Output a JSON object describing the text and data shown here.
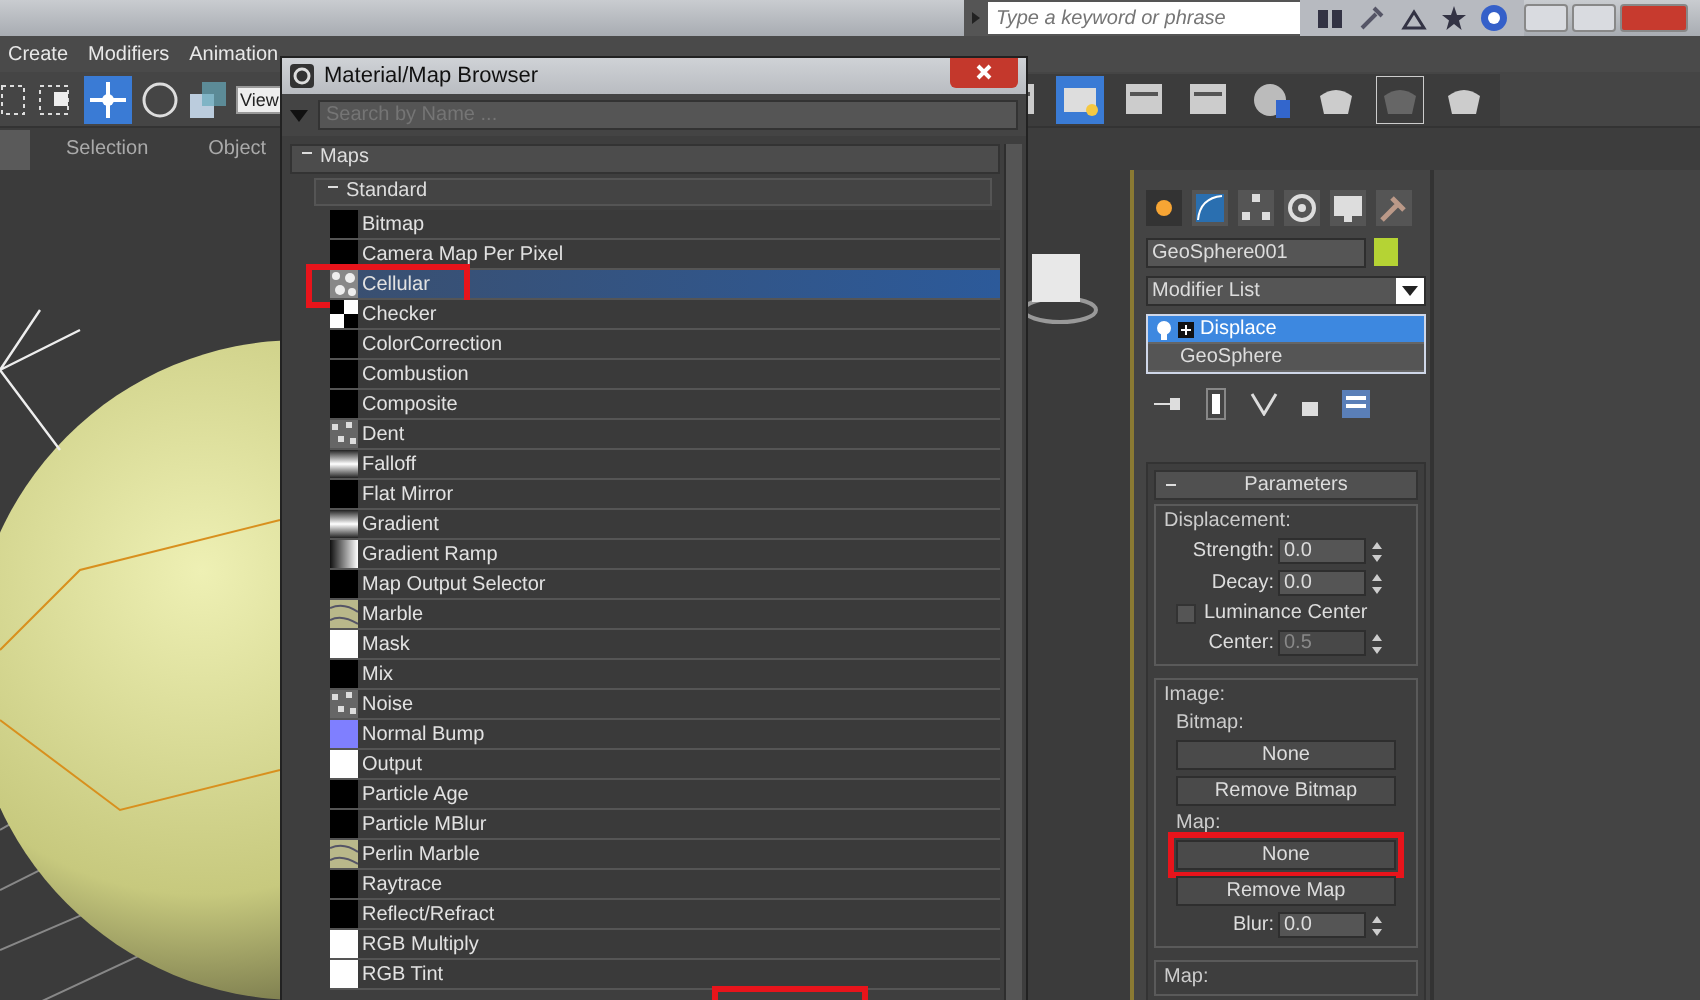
{
  "menu_bar": {
    "items": [
      "Create",
      "Modifiers",
      "Animation"
    ]
  },
  "search_bar": {
    "placeholder": "Type a keyword or phrase"
  },
  "toolbar": {
    "view_dropdown": "View"
  },
  "ribbon_tabs": [
    {
      "label": "Selection",
      "selected": false
    },
    {
      "label": "Object",
      "selected": false
    }
  ],
  "browser": {
    "title": "Material/Map Browser",
    "search": {
      "placeholder": "Search by Name ..."
    },
    "group": {
      "label": "Maps",
      "expanded": true
    },
    "subgroup": {
      "label": "Standard",
      "expanded": true
    },
    "maps": [
      {
        "name": "Bitmap",
        "kind": "solid",
        "color": "#000000",
        "selected": false,
        "highlighted": false
      },
      {
        "name": "Camera Map Per Pixel",
        "kind": "solid",
        "color": "#000000",
        "selected": false,
        "highlighted": false
      },
      {
        "name": "Cellular",
        "kind": "cellular",
        "selected": true,
        "highlighted": true
      },
      {
        "name": "Checker",
        "kind": "checker",
        "selected": false,
        "highlighted": false
      },
      {
        "name": "ColorCorrection",
        "kind": "solid",
        "color": "#000000",
        "selected": false,
        "highlighted": false
      },
      {
        "name": "Combustion",
        "kind": "solid",
        "color": "#000000",
        "selected": false,
        "highlighted": false
      },
      {
        "name": "Composite",
        "kind": "solid",
        "color": "#000000",
        "selected": false,
        "highlighted": false
      },
      {
        "name": "Dent",
        "kind": "noise",
        "selected": false,
        "highlighted": false
      },
      {
        "name": "Falloff",
        "kind": "gradient",
        "selected": false,
        "highlighted": false
      },
      {
        "name": "Flat Mirror",
        "kind": "solid",
        "color": "#000000",
        "selected": false,
        "highlighted": false
      },
      {
        "name": "Gradient",
        "kind": "gradient",
        "selected": false,
        "highlighted": false
      },
      {
        "name": "Gradient Ramp",
        "kind": "ramp",
        "selected": false,
        "highlighted": false
      },
      {
        "name": "Map Output Selector",
        "kind": "solid",
        "color": "#000000",
        "selected": false,
        "highlighted": false
      },
      {
        "name": "Marble",
        "kind": "marble",
        "selected": false,
        "highlighted": false
      },
      {
        "name": "Mask",
        "kind": "solid",
        "color": "#ffffff",
        "selected": false,
        "highlighted": false
      },
      {
        "name": "Mix",
        "kind": "solid",
        "color": "#000000",
        "selected": false,
        "highlighted": false
      },
      {
        "name": "Noise",
        "kind": "noise",
        "selected": false,
        "highlighted": false
      },
      {
        "name": "Normal Bump",
        "kind": "solid",
        "color": "#7f7fff",
        "selected": false,
        "highlighted": false
      },
      {
        "name": "Output",
        "kind": "solid",
        "color": "#ffffff",
        "selected": false,
        "highlighted": false
      },
      {
        "name": "Particle Age",
        "kind": "solid",
        "color": "#000000",
        "selected": false,
        "highlighted": false
      },
      {
        "name": "Particle MBlur",
        "kind": "solid",
        "color": "#000000",
        "selected": false,
        "highlighted": false
      },
      {
        "name": "Perlin Marble",
        "kind": "marble",
        "selected": false,
        "highlighted": false
      },
      {
        "name": "Raytrace",
        "kind": "solid",
        "color": "#000000",
        "selected": false,
        "highlighted": false
      },
      {
        "name": "Reflect/Refract",
        "kind": "solid",
        "color": "#000000",
        "selected": false,
        "highlighted": false
      },
      {
        "name": "RGB Multiply",
        "kind": "solid",
        "color": "#ffffff",
        "selected": false,
        "highlighted": false
      },
      {
        "name": "RGB Tint",
        "kind": "solid",
        "color": "#ffffff",
        "selected": false,
        "highlighted": false
      }
    ],
    "footer_highlight": true
  },
  "command_panel": {
    "object": {
      "name": "GeoSphere001",
      "color": "#b5d334"
    },
    "modifier_list": "Modifier List",
    "stack": [
      {
        "name": "Displace",
        "kind": "modifier",
        "selected": true
      },
      {
        "name": "GeoSphere",
        "kind": "base",
        "selected": false
      }
    ],
    "rollout": {
      "title": "Parameters",
      "expanded": true
    },
    "displacement": {
      "label": "Displacement:",
      "spinners": [
        {
          "label": "Strength:",
          "value": "0.0",
          "disabled": false
        },
        {
          "label": "Decay:",
          "value": "0.0",
          "disabled": false
        }
      ],
      "luminance": {
        "label": "Luminance Center",
        "checked": false
      },
      "center": {
        "label": "Center:",
        "value": "0.5",
        "disabled": true
      }
    },
    "image": {
      "label": "Image:",
      "bitmap_label": "Bitmap:",
      "bitmap_button": {
        "label": "None",
        "highlighted": false
      },
      "remove_bitmap": "Remove Bitmap",
      "map_label": "Map:",
      "map_button": {
        "label": "None",
        "highlighted": true
      },
      "remove_map": "Remove Map",
      "blur": {
        "label": "Blur:",
        "value": "0.0",
        "disabled": false
      }
    },
    "next_group_label": "Map:"
  }
}
